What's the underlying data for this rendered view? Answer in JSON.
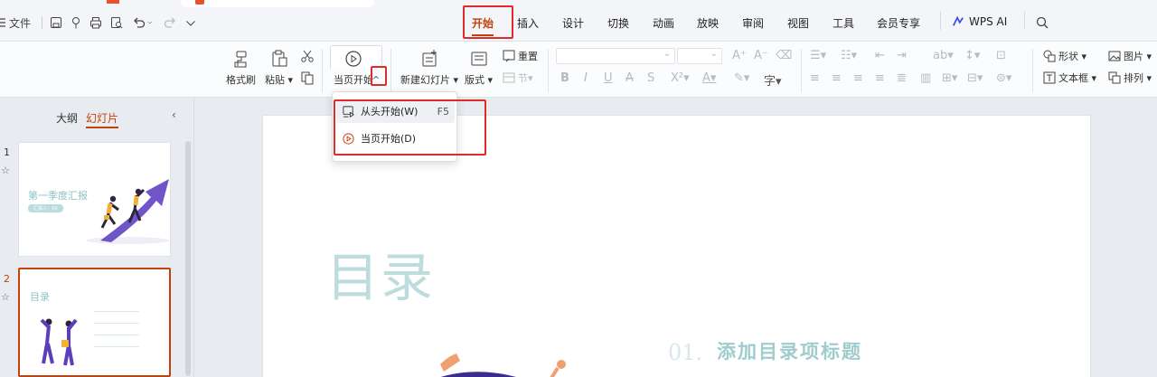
{
  "toolbar": {
    "file_label": "文件",
    "menu": [
      "开始",
      "插入",
      "设计",
      "切换",
      "动画",
      "放映",
      "审阅",
      "视图",
      "工具",
      "会员专享",
      "WPS AI"
    ]
  },
  "ribbon": {
    "format_painter": "格式刷",
    "paste": "粘贴",
    "play_current": "当页开始",
    "new_slide": "新建幻灯片",
    "layout": "版式",
    "reset": "重置",
    "section": "节",
    "shape": "形状",
    "picture": "图片",
    "textbox": "文本框",
    "arrange": "排列"
  },
  "dropdown": {
    "items": [
      {
        "label": "从头开始(W)",
        "shortcut": "F5"
      },
      {
        "label": "当页开始(D)",
        "shortcut": ""
      }
    ]
  },
  "left_panel": {
    "tab_outline": "大纲",
    "tab_slides": "幻灯片",
    "slides": [
      {
        "number": "1",
        "title": "第一季度汇报",
        "subtitle": "汇报人：XX"
      },
      {
        "number": "2",
        "title": "目录"
      }
    ]
  },
  "slide": {
    "title": "目录",
    "toc_number": "01.",
    "toc_title": "添加目录项标题"
  },
  "colors": {
    "accent": "#c2410c",
    "highlight_box": "#e02b2b",
    "slide_teal": "#bcdcdd",
    "illustration_purple": "#5b3fb8"
  }
}
